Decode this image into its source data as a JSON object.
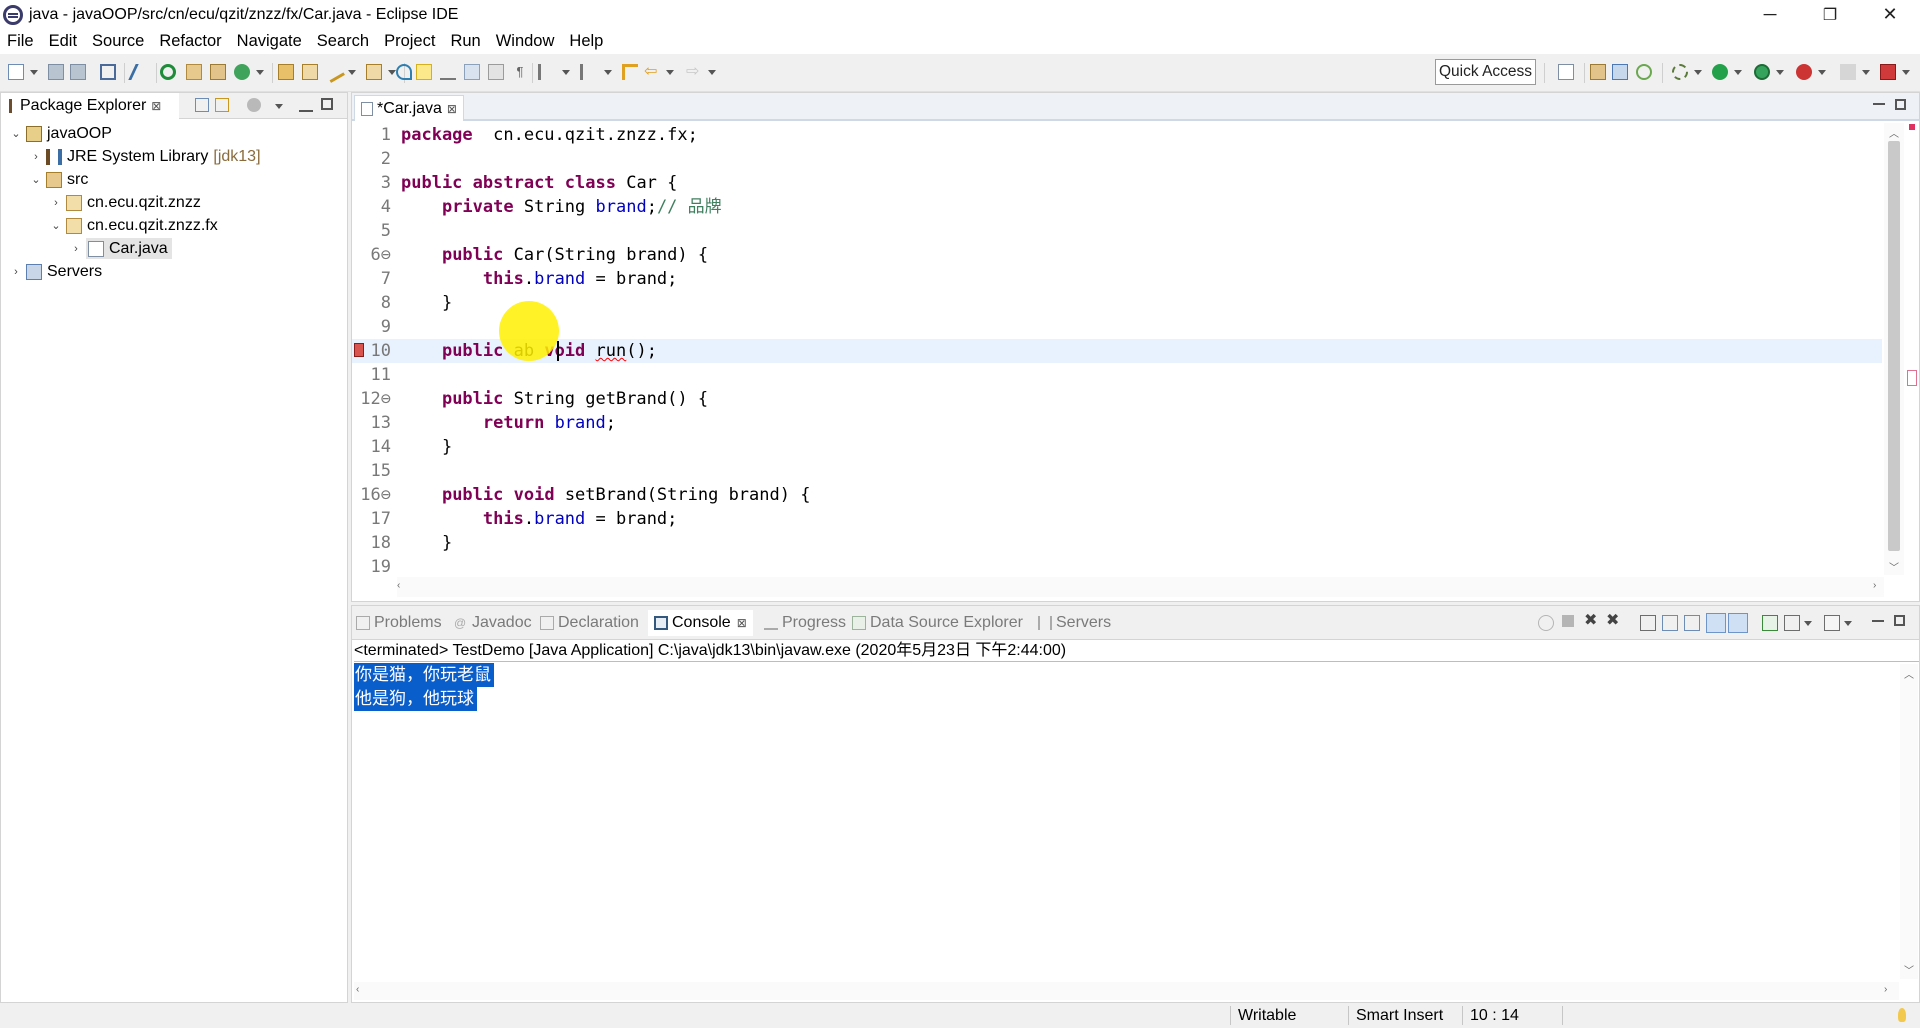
{
  "window": {
    "title": "java - javaOOP/src/cn/ecu/qzit/znzz/fx/Car.java - Eclipse IDE",
    "minimize": "─",
    "restore": "❐",
    "close": "✕"
  },
  "menu": [
    "File",
    "Edit",
    "Source",
    "Refactor",
    "Navigate",
    "Search",
    "Project",
    "Run",
    "Window",
    "Help"
  ],
  "toolbar": {
    "quick_access": "Quick Access"
  },
  "package_explorer": {
    "tab_label": "Package Explorer",
    "close_glyph": "⊠",
    "tree": [
      {
        "label": "javaOOP",
        "icon": "project-icon",
        "twisty": "⌄"
      },
      {
        "label": "JRE System Library",
        "suffix": "[jdk13]",
        "icon": "library-icon",
        "twisty": "›"
      },
      {
        "label": "src",
        "icon": "source-folder-icon",
        "twisty": "⌄"
      },
      {
        "label": "cn.ecu.qzit.znzz",
        "icon": "package-icon",
        "twisty": "›"
      },
      {
        "label": "cn.ecu.qzit.znzz.fx",
        "icon": "package-icon",
        "twisty": "⌄"
      },
      {
        "label": "Car.java",
        "icon": "java-file-icon",
        "twisty": "›"
      },
      {
        "label": "Servers",
        "icon": "folder-icon",
        "twisty": "›"
      }
    ]
  },
  "editor": {
    "tab_label": "*Car.java",
    "current_line": 10,
    "lines": [
      {
        "n": "1",
        "tokens": [
          [
            "kw",
            "package"
          ],
          [
            "",
            "  cn.ecu.qzit.znzz.fx;"
          ]
        ]
      },
      {
        "n": "2",
        "tokens": []
      },
      {
        "n": "3",
        "tokens": [
          [
            "kw",
            "public"
          ],
          [
            "",
            ""
          ],
          [
            "kw",
            " abstract"
          ],
          [
            "kw",
            " class"
          ],
          [
            "",
            " Car {"
          ]
        ]
      },
      {
        "n": "4",
        "tokens": [
          [
            "",
            "    "
          ],
          [
            "kw",
            "private"
          ],
          [
            "",
            " String "
          ],
          [
            "fld",
            "brand"
          ],
          [
            "",
            ";"
          ],
          [
            "cm",
            "// 品牌"
          ]
        ]
      },
      {
        "n": "5",
        "tokens": []
      },
      {
        "n": "6⊖",
        "tokens": [
          [
            "",
            "    "
          ],
          [
            "kw",
            "public"
          ],
          [
            "",
            " Car(String "
          ],
          [
            "",
            "brand) {"
          ]
        ]
      },
      {
        "n": "7",
        "tokens": [
          [
            "",
            "        "
          ],
          [
            "kw",
            "this"
          ],
          [
            "",
            "."
          ],
          [
            "fld",
            "brand"
          ],
          [
            "",
            " = brand;"
          ]
        ]
      },
      {
        "n": "8",
        "tokens": [
          [
            "",
            "    }"
          ]
        ]
      },
      {
        "n": "9",
        "tokens": []
      },
      {
        "n": "10",
        "tokens": [
          [
            "",
            "    "
          ],
          [
            "kw",
            "public"
          ],
          [
            "",
            " ab "
          ],
          [
            "kw",
            "void"
          ],
          [
            "",
            " "
          ],
          [
            "squig",
            "run"
          ],
          [
            "",
            "();"
          ]
        ]
      },
      {
        "n": "11",
        "tokens": []
      },
      {
        "n": "12⊖",
        "tokens": [
          [
            "",
            "    "
          ],
          [
            "kw",
            "public"
          ],
          [
            "",
            " String getBrand() {"
          ]
        ]
      },
      {
        "n": "13",
        "tokens": [
          [
            "",
            "        "
          ],
          [
            "kw",
            "return"
          ],
          [
            "",
            " "
          ],
          [
            "fld",
            "brand"
          ],
          [
            "",
            ";"
          ]
        ]
      },
      {
        "n": "14",
        "tokens": [
          [
            "",
            "    }"
          ]
        ]
      },
      {
        "n": "15",
        "tokens": []
      },
      {
        "n": "16⊖",
        "tokens": [
          [
            "",
            "    "
          ],
          [
            "kw",
            "public"
          ],
          [
            "",
            " "
          ],
          [
            "kw",
            "void"
          ],
          [
            "",
            " setBrand(String brand) {"
          ]
        ]
      },
      {
        "n": "17",
        "tokens": [
          [
            "",
            "        "
          ],
          [
            "kw",
            "this"
          ],
          [
            "",
            "."
          ],
          [
            "fld",
            "brand"
          ],
          [
            "",
            " = brand;"
          ]
        ]
      },
      {
        "n": "18",
        "tokens": [
          [
            "",
            "    }"
          ]
        ]
      },
      {
        "n": "19",
        "tokens": []
      }
    ]
  },
  "console_view": {
    "tabs": [
      {
        "label": "Problems",
        "icon": "problems-icon",
        "active": false
      },
      {
        "label": "Javadoc",
        "icon": "javadoc-icon",
        "active": false
      },
      {
        "label": "Declaration",
        "icon": "declaration-icon",
        "active": false
      },
      {
        "label": "Console",
        "icon": "console-icon",
        "active": true
      },
      {
        "label": "Progress",
        "icon": "progress-icon",
        "active": false
      },
      {
        "label": "Data Source Explorer",
        "icon": "datasource-icon",
        "active": false
      },
      {
        "label": "Servers",
        "icon": "servers-icon",
        "active": false
      }
    ],
    "close_glyph": "⊠",
    "header": "<terminated> TestDemo [Java Application] C:\\java\\jdk13\\bin\\javaw.exe (2020年5月23日 下午2:44:00)",
    "output": [
      "你是猫，你玩老鼠",
      "他是狗，他玩球"
    ]
  },
  "status": {
    "writable": "Writable",
    "insert_mode": "Smart Insert",
    "position": "10 : 14"
  },
  "colors": {
    "keyword": "#7f0055",
    "field": "#0000c0",
    "comment": "#3f7f5f",
    "selection": "#0a5ecb",
    "current_line": "#e8f2fe"
  }
}
